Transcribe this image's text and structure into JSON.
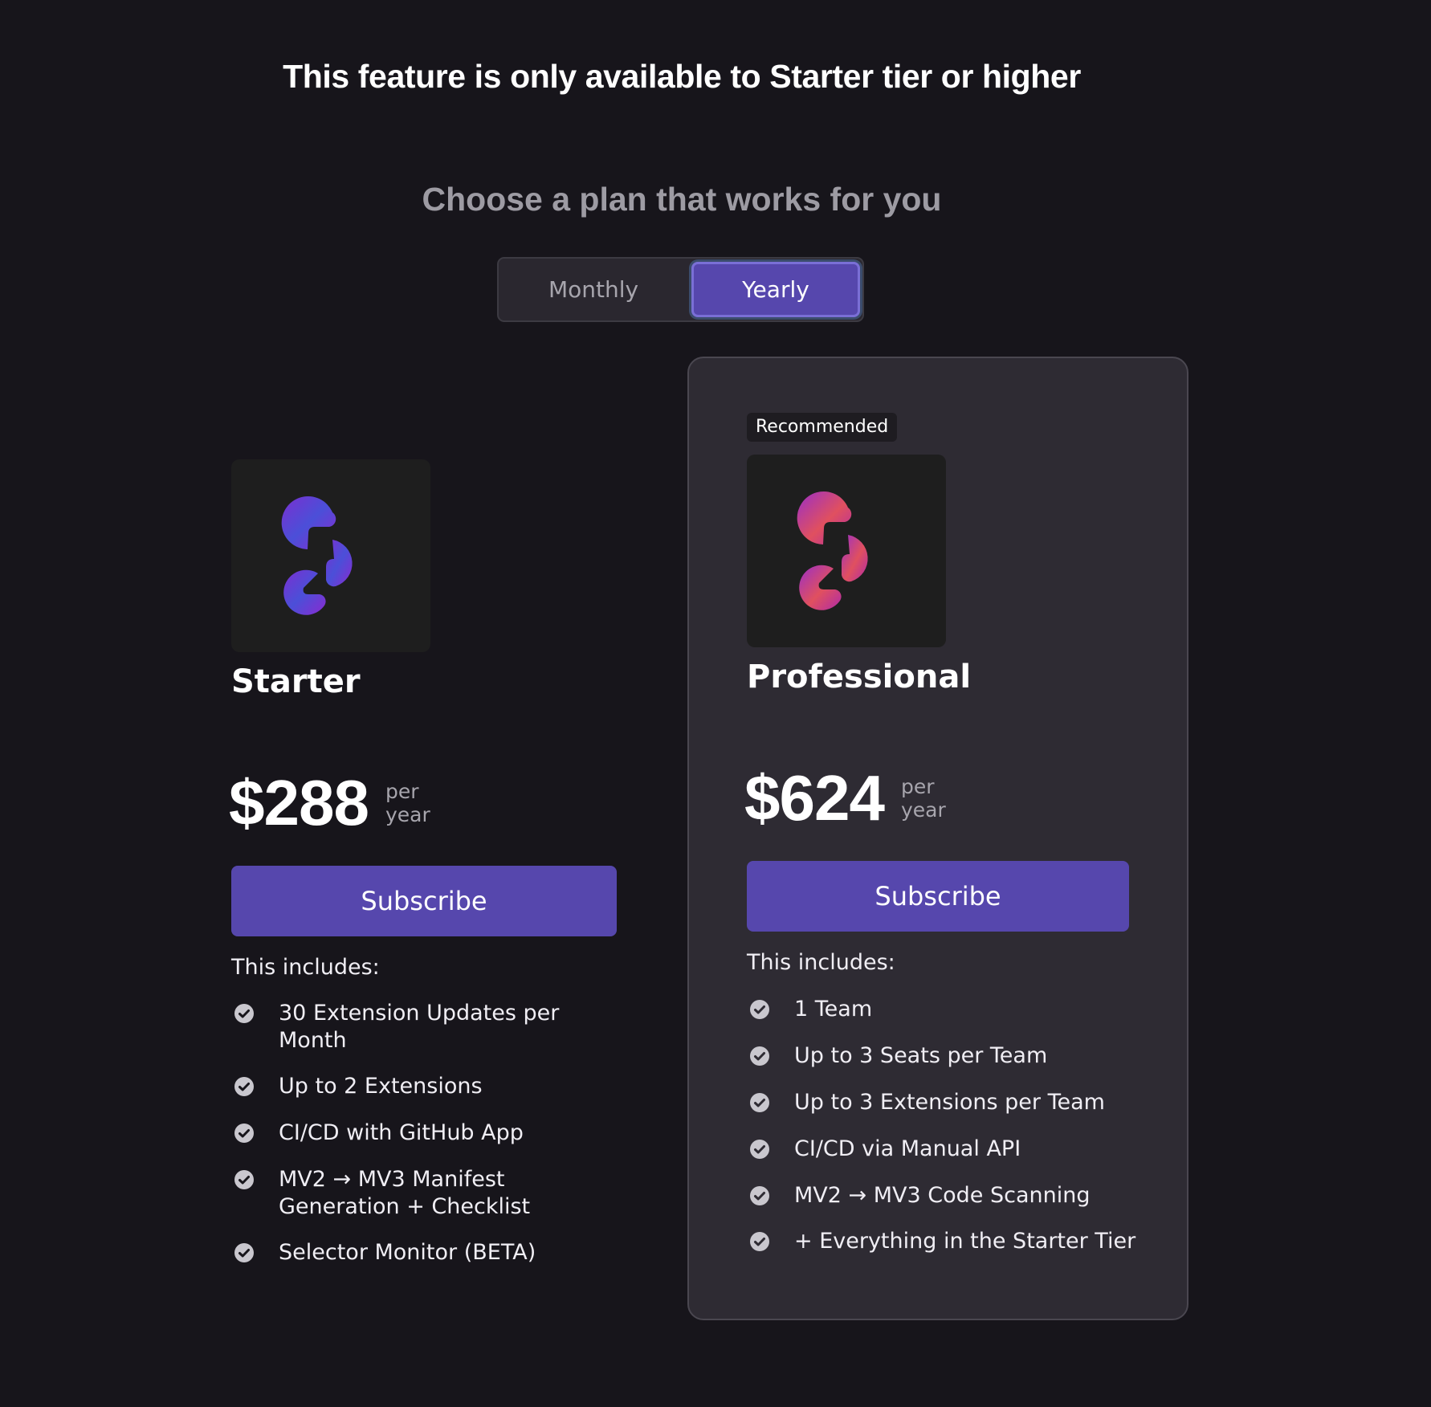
{
  "header": {
    "title": "This feature is only available to Starter tier or higher",
    "subtitle": "Choose a plan that works for you"
  },
  "billing_toggle": {
    "options": [
      "Monthly",
      "Yearly"
    ],
    "selected": "Yearly"
  },
  "plans": [
    {
      "name": "Starter",
      "price": "$288",
      "price_unit_line1": "per",
      "price_unit_line2": "year",
      "button_label": "Subscribe",
      "includes_label": "This includes:",
      "logo_icon": "logo-blue-purple-icon",
      "features": [
        "30 Extension Updates per Month",
        "Up to 2 Extensions",
        "CI/CD with GitHub App",
        "MV2 → MV3 Manifest Generation + Checklist",
        "Selector Monitor (BETA)"
      ]
    },
    {
      "name": "Professional",
      "badge": "Recommended",
      "price": "$624",
      "price_unit_line1": "per",
      "price_unit_line2": "year",
      "button_label": "Subscribe",
      "includes_label": "This includes:",
      "logo_icon": "logo-pink-purple-icon",
      "features": [
        "1 Team",
        "Up to 3 Seats per Team",
        "Up to 3 Extensions per Team",
        "CI/CD via Manual API",
        "MV2 → MV3 Code Scanning",
        "+ Everything in the Starter Tier"
      ]
    }
  ],
  "colors": {
    "background": "#17151b",
    "card": "#2e2b33",
    "accent": "#5647ad",
    "check": "#c9c7ce"
  }
}
